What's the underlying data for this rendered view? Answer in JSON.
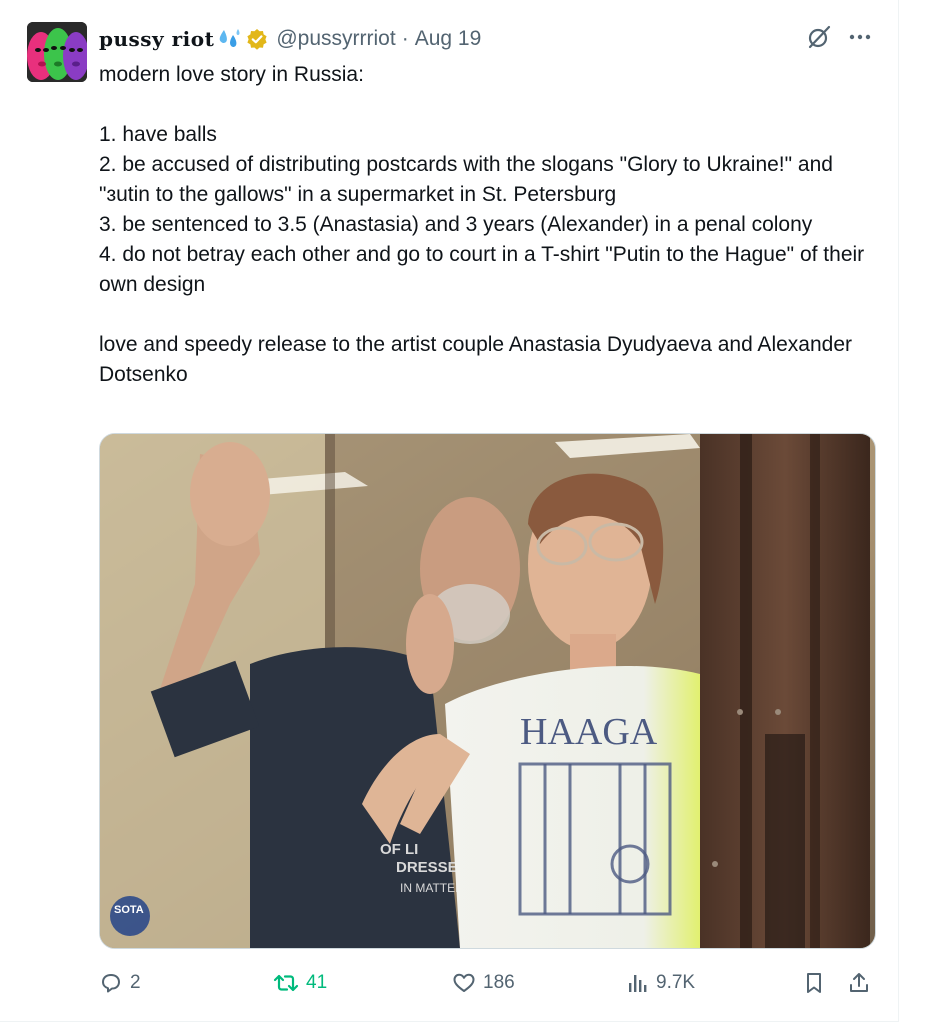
{
  "account": {
    "display_name": "pussy riot",
    "handle": "@pussyrrriot",
    "separator": "·",
    "date": "Aug 19"
  },
  "tweet": {
    "text": "modern love story in Russia:\n\n1. have balls\n2. be accused of distributing postcards with the slogans \"Glory to Ukraine!\" and \"ɜutin to the gallows\" in a supermarket in St. Petersburg\n3. be sentenced to 3.5 (Anastasia) and 3 years (Alexander) in a penal colony\n4. do not betray each other and go to court in a T-shirt \"Putin to the Hague\" of their own design\n\nlove and speedy release to the artist couple Anastasia Dyudyaeva and Alexander Dotsenko"
  },
  "media": {
    "shirt_text_woman": "HAAGA",
    "shirt_text_man": [
      "OF LI",
      "DRESSED",
      "IN MATTER"
    ],
    "watermark": "SOTA"
  },
  "actions": {
    "replies": "2",
    "retweets": "41",
    "likes": "186",
    "views": "9.7K"
  },
  "icons": {
    "verified": "verified-badge-icon",
    "emoji": "sweat-droplets-icon",
    "grok": "grok-icon",
    "more": "more-icon",
    "reply": "reply-icon",
    "retweet": "retweet-icon",
    "like": "heart-icon",
    "views": "views-icon",
    "bookmark": "bookmark-icon",
    "share": "share-icon"
  },
  "colors": {
    "text": "#0f1419",
    "secondary": "#536471",
    "retweet_active": "#00ba7c",
    "verified_gold": "#e2b719"
  }
}
